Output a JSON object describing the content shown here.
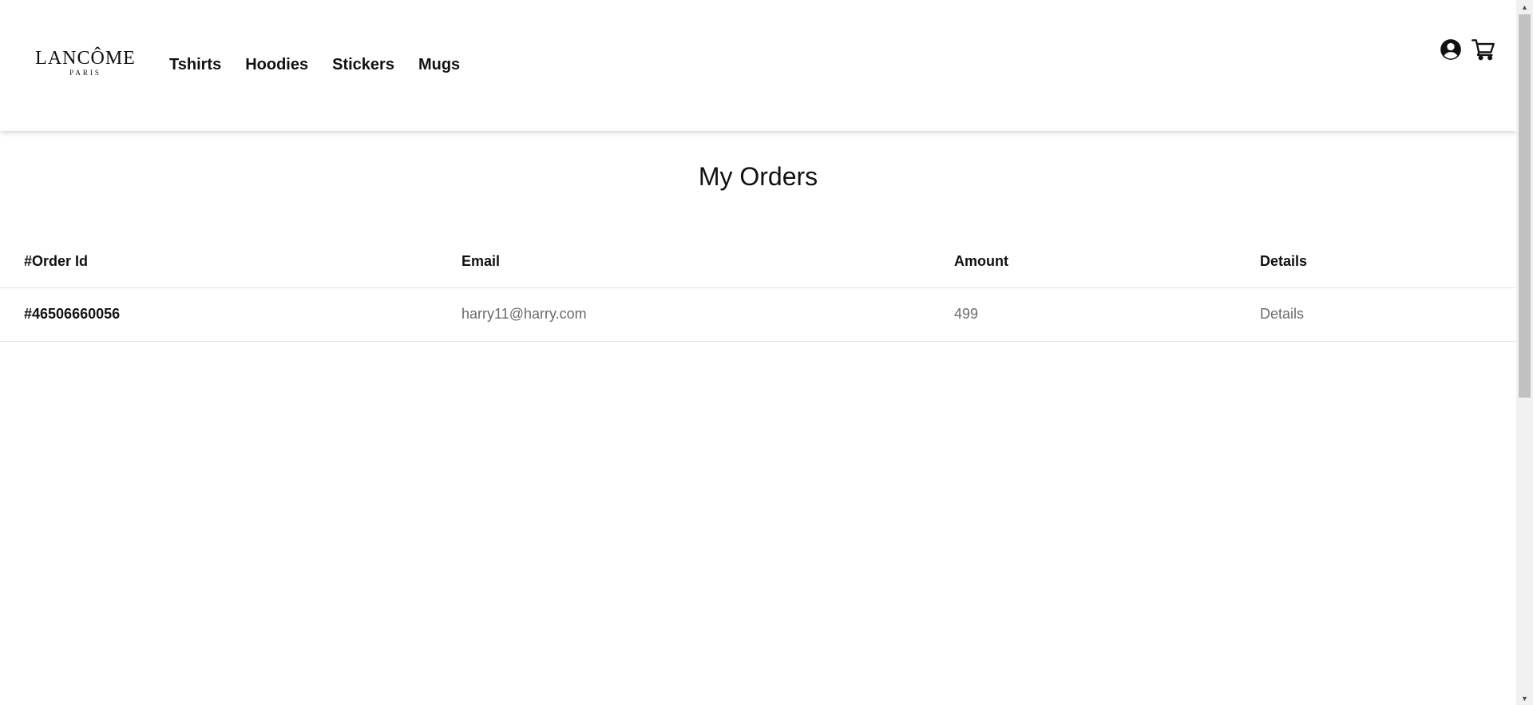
{
  "brand": {
    "name": "LANCÔME",
    "tagline": "PARIS"
  },
  "nav": {
    "items": [
      {
        "label": "Tshirts"
      },
      {
        "label": "Hoodies"
      },
      {
        "label": "Stickers"
      },
      {
        "label": "Mugs"
      }
    ]
  },
  "header_icons": {
    "account": "account-circle-icon",
    "cart": "shopping-cart-icon"
  },
  "page": {
    "title": "My Orders"
  },
  "table": {
    "headers": [
      "#Order Id",
      "Email",
      "Amount",
      "Details"
    ],
    "rows": [
      {
        "order_id": "#46506660056",
        "email": "harry11@harry.com",
        "amount": "499",
        "details": "Details"
      }
    ]
  },
  "colors": {
    "text": "#111111",
    "muted": "#6b6b6b",
    "divider": "#e3e3e3"
  }
}
